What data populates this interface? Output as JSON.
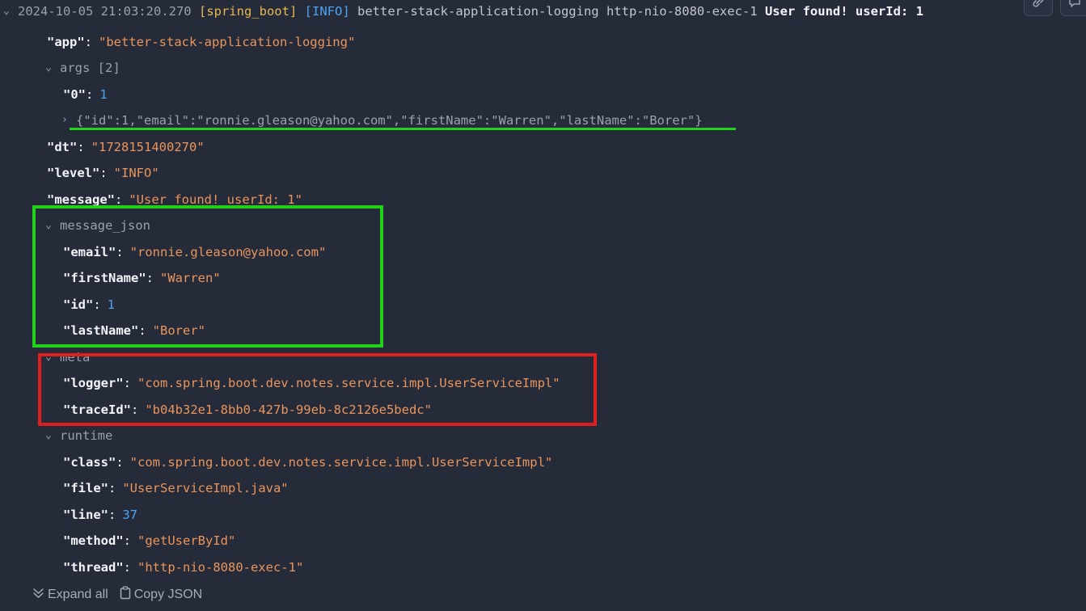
{
  "header": {
    "timestamp": "2024-10-05 21:03:20.270",
    "app_tag": "[spring_boot]",
    "level_tag": "[INFO]",
    "source": "better-stack-application-logging http-nio-8080-exec-1",
    "message": "User found! userId: 1"
  },
  "fields": {
    "app_key": "\"app\"",
    "app_val": "\"better-stack-application-logging\"",
    "args_label": "args [2]",
    "args0_key": "\"0\"",
    "args0_val": "1",
    "args1_text": "{\"id\":1,\"email\":\"ronnie.gleason@yahoo.com\",\"firstName\":\"Warren\",\"lastName\":\"Borer\"}",
    "dt_key": "\"dt\"",
    "dt_val": "\"1728151400270\"",
    "level_key": "\"level\"",
    "level_val": "\"INFO\"",
    "message_key": "\"message\"",
    "message_val": "\"User found! userId: 1\"",
    "message_json_label": "message_json",
    "email_key": "\"email\"",
    "email_val": "\"ronnie.gleason@yahoo.com\"",
    "firstName_key": "\"firstName\"",
    "firstName_val": "\"Warren\"",
    "id_key": "\"id\"",
    "id_val": "1",
    "lastName_key": "\"lastName\"",
    "lastName_val": "\"Borer\"",
    "meta_label": "meta",
    "logger_key": "\"logger\"",
    "logger_val": "\"com.spring.boot.dev.notes.service.impl.UserServiceImpl\"",
    "traceId_key": "\"traceId\"",
    "traceId_val": "\"b04b32e1-8bb0-427b-99eb-8c2126e5bedc\"",
    "runtime_label": "runtime",
    "class_key": "\"class\"",
    "class_val": "\"com.spring.boot.dev.notes.service.impl.UserServiceImpl\"",
    "file_key": "\"file\"",
    "file_val": "\"UserServiceImpl.java\"",
    "line_key": "\"line\"",
    "line_val": "37",
    "method_key": "\"method\"",
    "method_val": "\"getUserById\"",
    "thread_key": "\"thread\"",
    "thread_val": "\"http-nio-8080-exec-1\""
  },
  "footer": {
    "expand_all": "Expand all",
    "copy_json": "Copy JSON"
  },
  "colors": {
    "background": "#262b3a",
    "string": "#e9955b",
    "number": "#4ba3f2",
    "highlight_green": "#22cf19",
    "highlight_red": "#df1f1f"
  },
  "icons": [
    "chevron-down-icon",
    "chevron-right-icon",
    "link-icon",
    "comment-icon",
    "double-chevron-down-icon",
    "clipboard-icon"
  ]
}
